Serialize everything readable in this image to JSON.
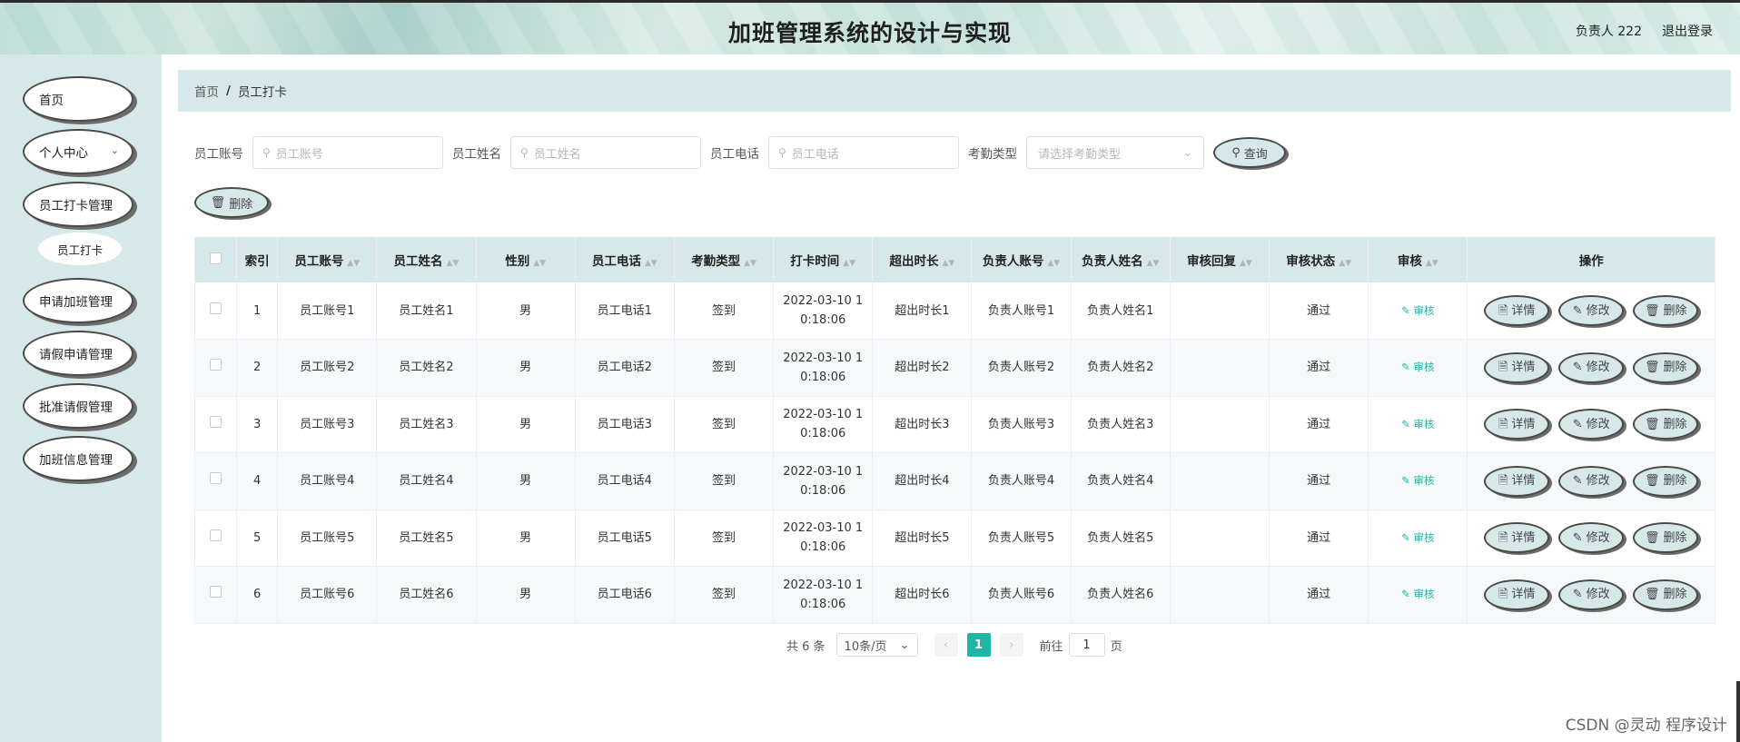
{
  "header": {
    "title": "加班管理系统的设计与实现",
    "user": "负责人 222",
    "logout": "退出登录"
  },
  "sidebar": {
    "items": [
      {
        "label": "首页"
      },
      {
        "label": "个人中心",
        "chevron": "chevron-down-icon"
      },
      {
        "label": "员工打卡管理"
      },
      {
        "label": "员工打卡"
      },
      {
        "label": "申请加班管理"
      },
      {
        "label": "请假申请管理"
      },
      {
        "label": "批准请假管理"
      },
      {
        "label": "加班信息管理"
      }
    ]
  },
  "breadcrumb": {
    "home": "首页",
    "separator": "/",
    "current": "员工打卡"
  },
  "search": {
    "account_label": "员工账号",
    "account_placeholder": "员工账号",
    "name_label": "员工姓名",
    "name_placeholder": "员工姓名",
    "phone_label": "员工电话",
    "phone_placeholder": "员工电话",
    "type_label": "考勤类型",
    "type_placeholder": "请选择考勤类型",
    "query_label": "查询"
  },
  "toolbar": {
    "delete_label": "删除"
  },
  "table": {
    "headers": [
      "索引",
      "员工账号",
      "员工姓名",
      "性别",
      "员工电话",
      "考勤类型",
      "打卡时间",
      "超出时长",
      "负责人账号",
      "负责人姓名",
      "审核回复",
      "审核状态",
      "审核",
      "操作"
    ],
    "rows": [
      {
        "index": "1",
        "account": "员工账号1",
        "name": "员工姓名1",
        "gender": "男",
        "phone": "员工电话1",
        "type": "签到",
        "time_1": "2022-03-10 1",
        "time_2": "0:18:06",
        "overtime": "超出时长1",
        "mgr_account": "负责人账号1",
        "mgr_name": "负责人姓名1",
        "reply": "",
        "status": "通过"
      },
      {
        "index": "2",
        "account": "员工账号2",
        "name": "员工姓名2",
        "gender": "男",
        "phone": "员工电话2",
        "type": "签到",
        "time_1": "2022-03-10 1",
        "time_2": "0:18:06",
        "overtime": "超出时长2",
        "mgr_account": "负责人账号2",
        "mgr_name": "负责人姓名2",
        "reply": "",
        "status": "通过"
      },
      {
        "index": "3",
        "account": "员工账号3",
        "name": "员工姓名3",
        "gender": "男",
        "phone": "员工电话3",
        "type": "签到",
        "time_1": "2022-03-10 1",
        "time_2": "0:18:06",
        "overtime": "超出时长3",
        "mgr_account": "负责人账号3",
        "mgr_name": "负责人姓名3",
        "reply": "",
        "status": "通过"
      },
      {
        "index": "4",
        "account": "员工账号4",
        "name": "员工姓名4",
        "gender": "男",
        "phone": "员工电话4",
        "type": "签到",
        "time_1": "2022-03-10 1",
        "time_2": "0:18:06",
        "overtime": "超出时长4",
        "mgr_account": "负责人账号4",
        "mgr_name": "负责人姓名4",
        "reply": "",
        "status": "通过"
      },
      {
        "index": "5",
        "account": "员工账号5",
        "name": "员工姓名5",
        "gender": "男",
        "phone": "员工电话5",
        "type": "签到",
        "time_1": "2022-03-10 1",
        "time_2": "0:18:06",
        "overtime": "超出时长5",
        "mgr_account": "负责人账号5",
        "mgr_name": "负责人姓名5",
        "reply": "",
        "status": "通过"
      },
      {
        "index": "6",
        "account": "员工账号6",
        "name": "员工姓名6",
        "gender": "男",
        "phone": "员工电话6",
        "type": "签到",
        "time_1": "2022-03-10 1",
        "time_2": "0:18:06",
        "overtime": "超出时长6",
        "mgr_account": "负责人账号6",
        "mgr_name": "负责人姓名6",
        "reply": "",
        "status": "通过"
      }
    ],
    "audit_link": "审核",
    "actions": {
      "detail": "详情",
      "edit": "修改",
      "delete": "删除"
    }
  },
  "pagination": {
    "total": "共 6 条",
    "page_size": "10条/页",
    "current_page": "1",
    "goto_label": "前往",
    "goto_value": "1",
    "page_unit": "页"
  },
  "watermark": "CSDN @灵动 程序设计",
  "colors": {
    "accent": "#1fb5a7",
    "panel": "#d7e8ea"
  }
}
